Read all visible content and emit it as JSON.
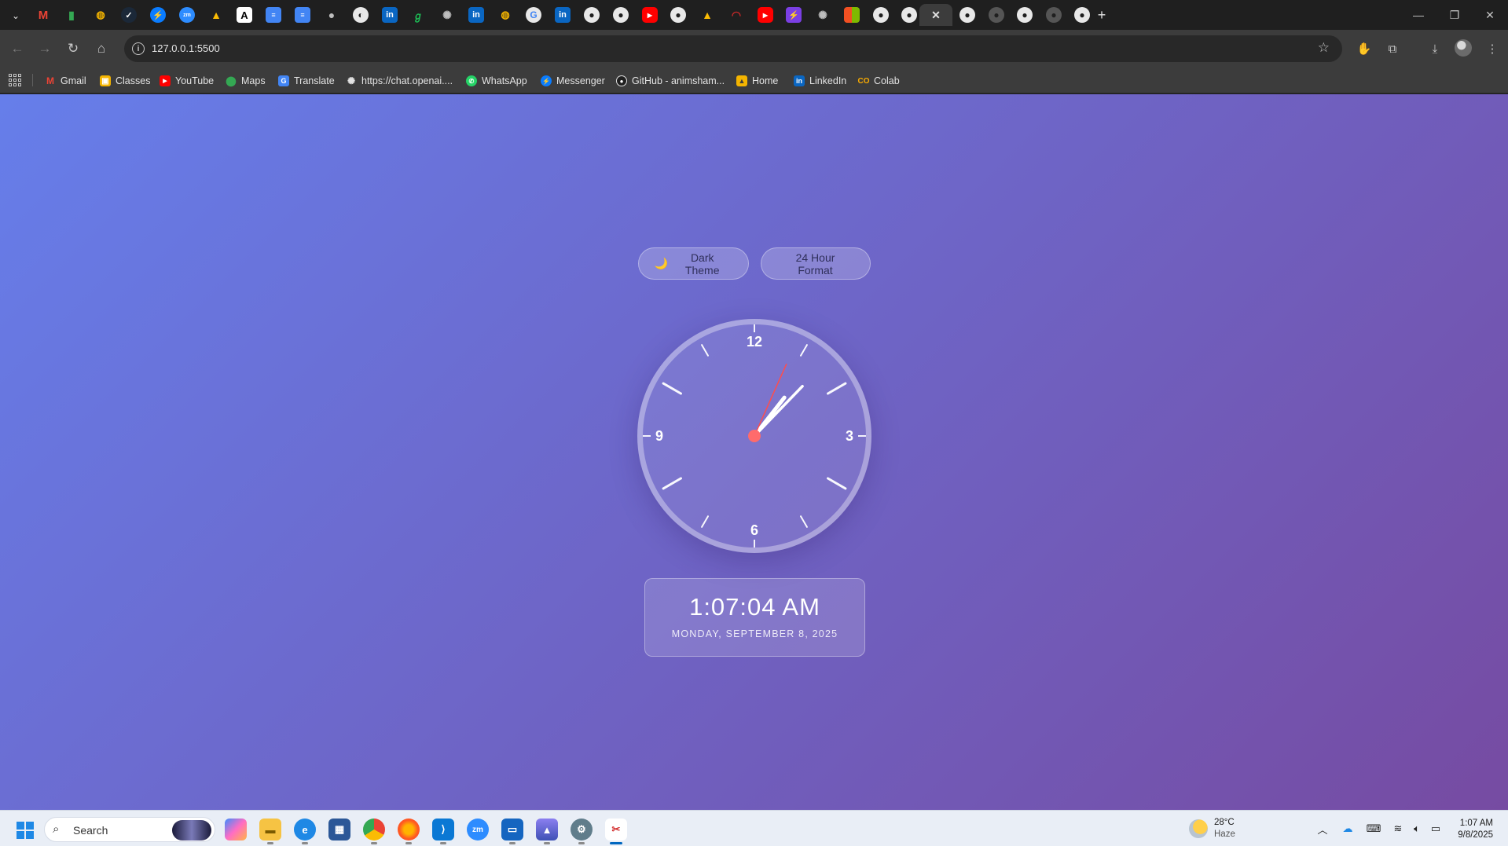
{
  "browser": {
    "url": "127.0.0.1:5500",
    "bookmarks": [
      {
        "label": "Gmail",
        "icon": "gmail-icon"
      },
      {
        "label": "Classes",
        "icon": "classroom-icon"
      },
      {
        "label": "YouTube",
        "icon": "youtube-icon"
      },
      {
        "label": "Maps",
        "icon": "maps-icon"
      },
      {
        "label": "Translate",
        "icon": "translate-icon"
      },
      {
        "label": "https://chat.openai....",
        "icon": "openai-icon"
      },
      {
        "label": "WhatsApp",
        "icon": "whatsapp-icon"
      },
      {
        "label": "Messenger",
        "icon": "messenger-icon"
      },
      {
        "label": "GitHub - animsham...",
        "icon": "github-icon"
      },
      {
        "label": "Home",
        "icon": "home-folder-icon"
      },
      {
        "label": "LinkedIn",
        "icon": "linkedin-icon"
      },
      {
        "label": "Colab",
        "icon": "colab-icon"
      }
    ]
  },
  "page": {
    "theme_button_icon": "🌙",
    "theme_button_label": "Dark Theme",
    "format_button_label": "24 Hour Format",
    "clock_numbers": {
      "twelve": "12",
      "three": "3",
      "six": "6",
      "nine": "9"
    },
    "digital_time": "1:07:04 AM",
    "digital_date": "MONDAY, SEPTEMBER 8, 2025",
    "analog_time": {
      "hours": 1,
      "minutes": 7,
      "seconds": 4
    },
    "colors": {
      "gradient_start": "#667eea",
      "gradient_end": "#764ba2",
      "second_hand": "#ff4d4d"
    }
  },
  "taskbar": {
    "search_placeholder": "Search",
    "weather_temp": "28°C",
    "weather_desc": "Haze",
    "time": "1:07 AM",
    "date": "9/8/2025"
  }
}
